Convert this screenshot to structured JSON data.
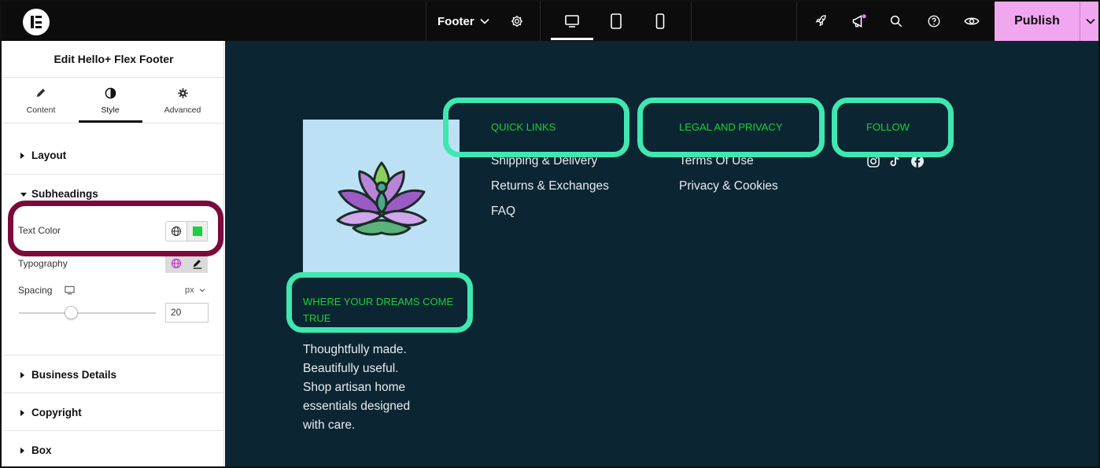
{
  "topbar": {
    "document_title": "Footer",
    "publish_label": "Publish",
    "icons": [
      "elementor-logo-icon",
      "chevron-down-icon",
      "settings-gear-icon",
      "desktop-icon",
      "tablet-icon",
      "mobile-icon",
      "rocket-icon",
      "megaphone-icon",
      "search-icon",
      "help-icon",
      "preview-eye-icon"
    ],
    "publish_color": "#f0a7f0",
    "notification_dot_color": "#e77be7"
  },
  "panel": {
    "title": "Edit Hello+ Flex Footer",
    "tabs": [
      {
        "label": "Content",
        "icon": "pencil-icon",
        "active": false
      },
      {
        "label": "Style",
        "icon": "contrast-icon",
        "active": true
      },
      {
        "label": "Advanced",
        "icon": "gear-icon",
        "active": false
      }
    ],
    "sections": {
      "layout": "Layout",
      "subheadings": "Subheadings",
      "business_details": "Business Details",
      "copyright": "Copyright",
      "box": "Box"
    },
    "controls": {
      "text_color_label": "Text Color",
      "text_color_value": "#19d13a",
      "typography_label": "Typography",
      "spacing_label": "Spacing",
      "spacing_unit": "px",
      "spacing_value": "20"
    }
  },
  "footer": {
    "subheadings": {
      "quick_links": "QUICK LINKS",
      "legal": "LEGAL AND PRIVACY",
      "follow": "FOLLOW",
      "brand": "WHERE YOUR DREAMS COME TRUE"
    },
    "quick_links": [
      "Shipping & Delivery",
      "Returns & Exchanges",
      "FAQ"
    ],
    "legal_links": [
      "Terms Of Use",
      "Privacy & Cookies"
    ],
    "social": [
      "instagram-icon",
      "tiktok-icon",
      "facebook-icon"
    ],
    "tagline": "Thoughtfully made. Beautifully useful. Shop artisan home essentials designed with care.",
    "background_color": "#0b2533",
    "subheading_color": "#19d13a",
    "logo": "lotus-logo-icon"
  },
  "annotations": {
    "maroon_highlight": "#7a0a3c",
    "green_highlight": "#3ee8b0"
  }
}
